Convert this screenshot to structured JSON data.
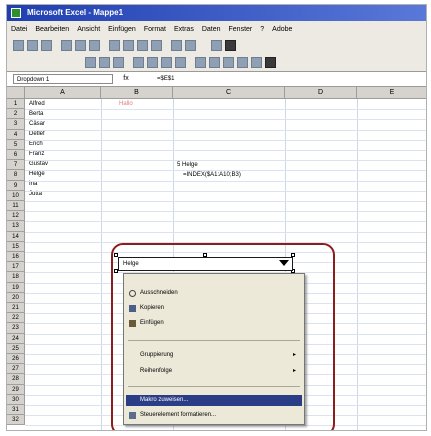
{
  "window": {
    "title": "Microsoft Excel - Mappe1"
  },
  "menu": [
    "Datei",
    "Bearbeiten",
    "Ansicht",
    "Einfügen",
    "Format",
    "Extras",
    "Daten",
    "Fenster",
    "?",
    "Adobe"
  ],
  "formula_bar": {
    "name_box": "Dropdown 1",
    "fx": "fx",
    "value": "=$E$1"
  },
  "columns": [
    "A",
    "B",
    "C",
    "D",
    "E"
  ],
  "rows": [
    "1",
    "2",
    "3",
    "4",
    "5",
    "6",
    "7",
    "8",
    "9",
    "10",
    "11",
    "12",
    "13",
    "14",
    "15",
    "16",
    "17",
    "18",
    "19",
    "20",
    "21",
    "22",
    "23",
    "24",
    "25",
    "26",
    "27",
    "28",
    "29",
    "30",
    "31",
    "32"
  ],
  "cells": {
    "a1": "Alfred",
    "a2": "Berta",
    "a3": "Cäsar",
    "a4": "Detlef",
    "a5": "Erich",
    "a6": "Franz",
    "a7": "Gustav",
    "a8": "Helge",
    "a9": "Ina",
    "a10": "Jutta",
    "b1": "Hallo",
    "c3": "5 Helge",
    "c4": "=INDEX($A1:A10;B3)"
  },
  "combo": {
    "value": "Helge"
  },
  "context_menu": {
    "items": [
      {
        "label": "Ausschneiden",
        "icon": "scissors-icon"
      },
      {
        "label": "Kopieren",
        "icon": "copy-icon"
      },
      {
        "label": "Einfügen",
        "icon": "paste-icon"
      },
      {
        "label": "Gruppierung",
        "icon": "",
        "submenu": true
      },
      {
        "label": "Reihenfolge",
        "icon": "",
        "submenu": true
      },
      {
        "label": "Makro zuweisen...",
        "icon": "",
        "highlighted": true
      },
      {
        "label": "Steuerelement formatieren...",
        "icon": "format-control-icon"
      }
    ]
  },
  "colors": {
    "title_bar": "#2a4bbf",
    "highlight": "#2b3d86",
    "callout": "#8c1d1d"
  }
}
